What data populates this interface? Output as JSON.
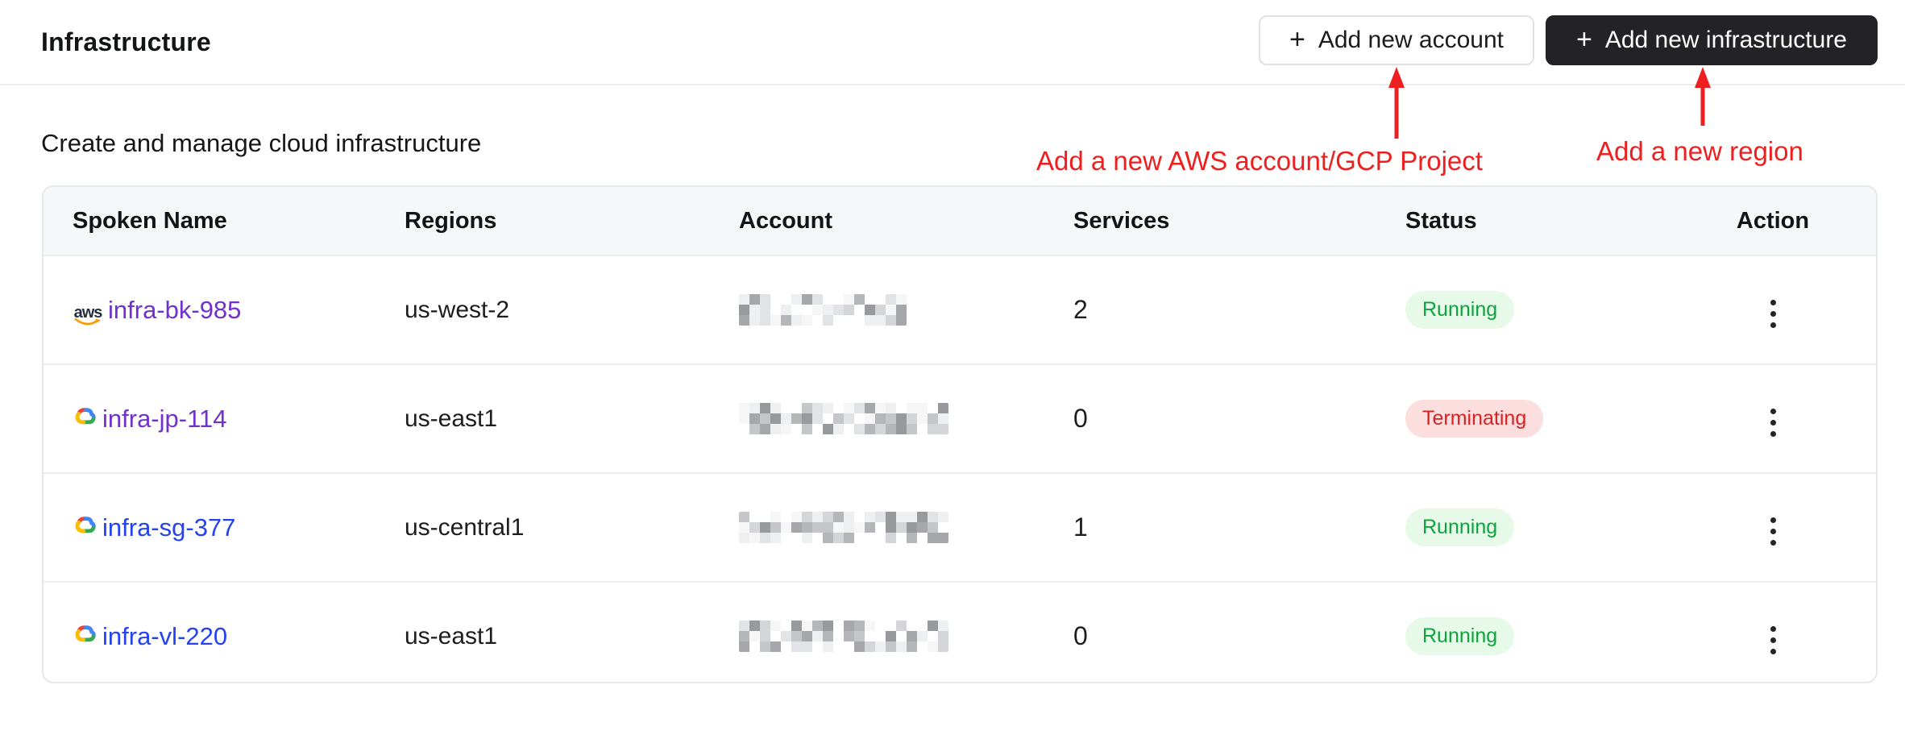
{
  "page": {
    "title": "Infrastructure",
    "subtitle": "Create and manage cloud infrastructure"
  },
  "header": {
    "add_account_label": "Add new account",
    "add_infra_label": "Add new infrastructure",
    "plus_icon": "+"
  },
  "annotations": {
    "account_note": "Add a new AWS account/GCP Project",
    "region_note": "Add a new region",
    "color": "#ee1f1f"
  },
  "table": {
    "columns": [
      "Spoken Name",
      "Regions",
      "Account",
      "Services",
      "Status",
      "Action"
    ],
    "rows": [
      {
        "name": "infra-bk-985",
        "provider": "aws",
        "visited": true,
        "region": "us-west-2",
        "account": {
          "redacted": true,
          "redacted_width": 214
        },
        "services": "2",
        "status": "Running"
      },
      {
        "name": "infra-jp-114",
        "provider": "gcp",
        "visited": true,
        "region": "us-east1",
        "account": {
          "redacted": true,
          "redacted_width": 258
        },
        "services": "0",
        "status": "Terminating"
      },
      {
        "name": "infra-sg-377",
        "provider": "gcp",
        "visited": false,
        "region": "us-central1",
        "account": {
          "redacted": true,
          "redacted_width": 266
        },
        "services": "1",
        "status": "Running"
      },
      {
        "name": "infra-vl-220",
        "provider": "gcp",
        "visited": false,
        "region": "us-east1",
        "account": {
          "redacted": true,
          "redacted_width": 260
        },
        "services": "0",
        "status": "Running"
      }
    ],
    "status_styles": {
      "Running": {
        "bg": "#e7fae9",
        "text": "#0da33c"
      },
      "Terminating": {
        "bg": "#fcdede",
        "text": "#d52222"
      }
    },
    "link_colors": {
      "visited": "#7031cc",
      "unvisited": "#2442f0"
    },
    "provider_colors": {
      "aws_navy": "#252f3e",
      "aws_orange": "#ff9900",
      "gcp_red": "#ea4335",
      "gcp_blue": "#4285f4",
      "gcp_green": "#34a853",
      "gcp_yellow": "#fbbc05"
    }
  }
}
